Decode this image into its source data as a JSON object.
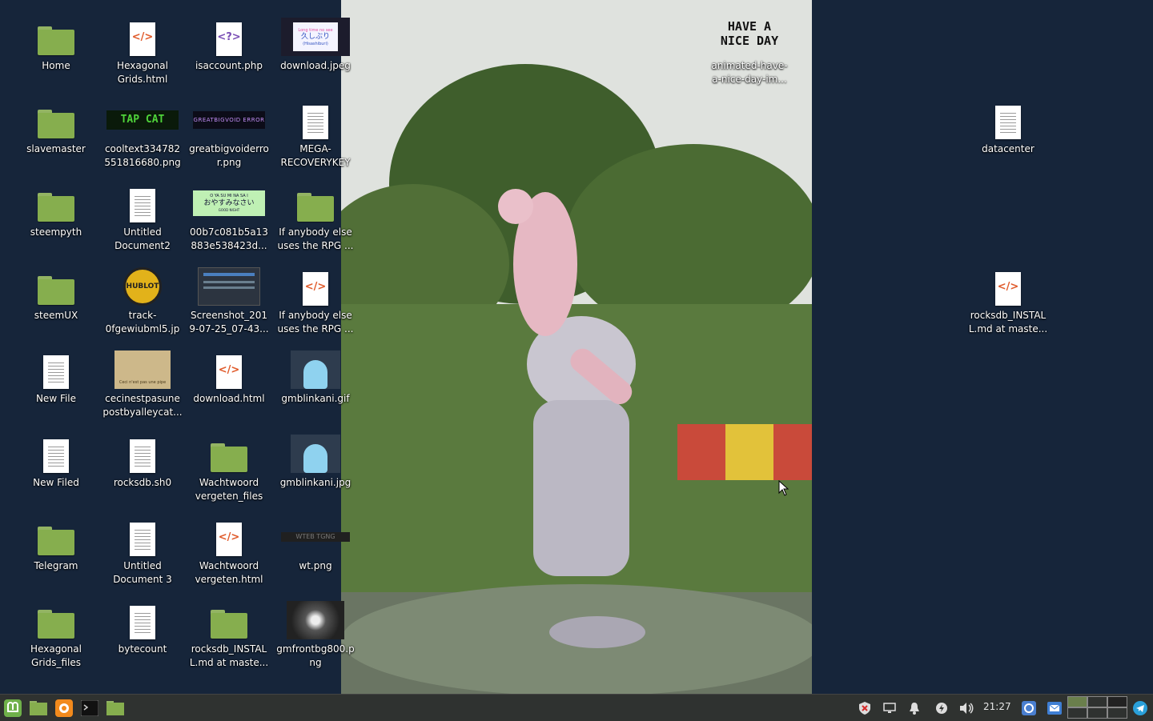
{
  "desktop": {
    "icons": [
      {
        "label": "Home",
        "kind": "folder-home"
      },
      {
        "label": "slavemaster",
        "kind": "folder"
      },
      {
        "label": "steempyth",
        "kind": "folder"
      },
      {
        "label": "steemUX",
        "kind": "folder"
      },
      {
        "label": "New File",
        "kind": "text"
      },
      {
        "label": "New Filed",
        "kind": "text"
      },
      {
        "label": "Telegram",
        "kind": "folder"
      },
      {
        "label": "Hexagonal Grids_files",
        "kind": "folder"
      },
      {
        "label": "Hexagonal Grids.html",
        "kind": "html"
      },
      {
        "label": "cooltext334782551816680.png",
        "kind": "image"
      },
      {
        "label": "Untitled Document2",
        "kind": "text"
      },
      {
        "label": "track-0fgewiubml5.jpg",
        "kind": "image"
      },
      {
        "label": "cecinestpasunepostbyalleycat...",
        "kind": "image"
      },
      {
        "label": "rocksdb.sh0",
        "kind": "text"
      },
      {
        "label": "Untitled Document 3",
        "kind": "text"
      },
      {
        "label": "bytecount",
        "kind": "text"
      },
      {
        "label": "isaccount.php",
        "kind": "php"
      },
      {
        "label": "greatbigvoiderror.png",
        "kind": "image"
      },
      {
        "label": "00b7c081b5a13883e538423d...",
        "kind": "image"
      },
      {
        "label": "Screenshot_2019-07-25_07-43...",
        "kind": "image"
      },
      {
        "label": "download.html",
        "kind": "html"
      },
      {
        "label": "Wachtwoord vergeten_files",
        "kind": "folder"
      },
      {
        "label": "Wachtwoord vergeten.html",
        "kind": "html"
      },
      {
        "label": "rocksdb_INSTALL.md at maste...",
        "kind": "folder"
      },
      {
        "label": "download.jpeg",
        "kind": "image"
      },
      {
        "label": "MEGA-RECOVERYKEY",
        "kind": "text"
      },
      {
        "label": "If anybody else uses the RPG ...",
        "kind": "folder"
      },
      {
        "label": "If anybody else uses the RPG ...",
        "kind": "html"
      },
      {
        "label": "gmblinkani.gif",
        "kind": "image"
      },
      {
        "label": "gmblinkani.jpg",
        "kind": "image"
      },
      {
        "label": "wt.png",
        "kind": "image"
      },
      {
        "label": "gmfrontbg800.png",
        "kind": "image"
      },
      {
        "label": "animated-have-a-nice-day-im...",
        "kind": "image"
      },
      {
        "label": "datacenter",
        "kind": "text"
      },
      {
        "label": "rocksdb_INSTALL.md at maste...",
        "kind": "html"
      }
    ],
    "thumb_texts": {
      "cooltext": "TAP CAT",
      "greatbigvoid": "GREATBIGVOID ERROR",
      "oyasumi_1": "O YA SU MI NA SA I",
      "oyasumi_2": "おやすみなさい",
      "oyasumi_3": "GOOD NIGHT",
      "download_1": "Long time no see",
      "download_2": "久しぶり",
      "download_3": "(Hisashiburi)",
      "niceday": "HAVE A NICE DAY",
      "track": "HUBLOT",
      "cecinest": "Ceci n'est pas une pipe",
      "wt": "WTEB TGNG"
    }
  },
  "taskbar": {
    "clock": "21:27",
    "launchers": [
      "mint-menu-icon",
      "folder-icon",
      "firefox-icon",
      "terminal-icon",
      "files-icon"
    ],
    "tray": [
      "shield-icon",
      "display-icon",
      "bell-icon",
      "power-icon",
      "volume-icon",
      "chromium-icon",
      "mail-icon",
      "telegram-icon"
    ]
  },
  "colors": {
    "desktop_bg": "#16253a",
    "taskbar_bg": "#2f3230",
    "folder_green": "#86ae4e",
    "mint_green": "#6fb04a"
  }
}
